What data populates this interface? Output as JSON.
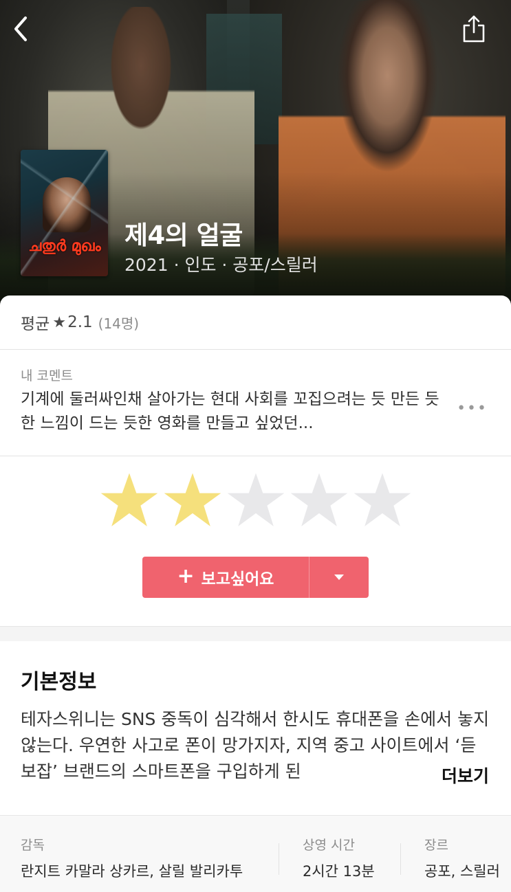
{
  "header": {
    "title": "제4의 얼굴",
    "meta": "2021 · 인도 · 공포/스릴러",
    "poster_title": "ചതുർ മുഖം"
  },
  "rating_summary": {
    "label": "평균",
    "star_glyph": "★",
    "value": "2.1",
    "count": "(14명)"
  },
  "my_comment": {
    "label": "내 코멘트",
    "text": "기계에 둘러싸인채 살아가는 현대 사회를 꼬집으려는 듯 만든 듯한 느낌이 드는 듯한 영화를 만들고 싶었던...",
    "more_glyph": "•••"
  },
  "my_rating": {
    "value": 2,
    "max": 5,
    "filled_color": "#f5e07c",
    "empty_color": "#e8e8ea"
  },
  "wishlist": {
    "plus": "+",
    "label": "보고싶어요",
    "color": "#f0636e"
  },
  "basic_info": {
    "title": "기본정보",
    "description": "테자스위니는 SNS 중독이 심각해서 한시도 휴대폰을 손에서 놓지 않는다. 우연한 사고로 폰이 망가지자, 지역 중고 사이트에서 ‘듣보잡’ 브랜드의 스마트폰을 구입하게 된",
    "more": "더보기"
  },
  "credits": [
    {
      "key": "감독",
      "value": "란지트 카말라 상카르, 살릴 발리카투"
    },
    {
      "key": "상영 시간",
      "value": "2시간 13분"
    },
    {
      "key": "장르",
      "value": "공포, 스릴러"
    }
  ],
  "icons": {
    "back": "chevron-left-icon",
    "share": "share-icon",
    "dropdown": "caret-down-icon",
    "more": "more-horizontal-icon"
  }
}
